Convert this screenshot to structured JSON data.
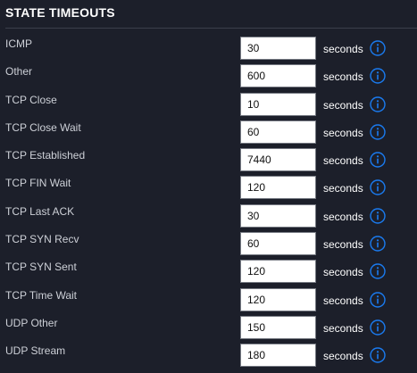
{
  "section": {
    "title": "STATE TIMEOUTS"
  },
  "colors": {
    "background": "#1c1f2a",
    "info_icon": "#1a7bf0",
    "input_border": "#767a83",
    "divider": "#3b3f4c"
  },
  "icons": {
    "info": "info-circle-icon"
  },
  "rows": [
    {
      "label": "ICMP",
      "value": "30",
      "unit": "seconds"
    },
    {
      "label": "Other",
      "value": "600",
      "unit": "seconds"
    },
    {
      "label": "TCP Close",
      "value": "10",
      "unit": "seconds"
    },
    {
      "label": "TCP Close Wait",
      "value": "60",
      "unit": "seconds"
    },
    {
      "label": "TCP Established",
      "value": "7440",
      "unit": "seconds"
    },
    {
      "label": "TCP FIN Wait",
      "value": "120",
      "unit": "seconds"
    },
    {
      "label": "TCP Last ACK",
      "value": "30",
      "unit": "seconds"
    },
    {
      "label": "TCP SYN Recv",
      "value": "60",
      "unit": "seconds"
    },
    {
      "label": "TCP SYN Sent",
      "value": "120",
      "unit": "seconds"
    },
    {
      "label": "TCP Time Wait",
      "value": "120",
      "unit": "seconds"
    },
    {
      "label": "UDP Other",
      "value": "150",
      "unit": "seconds"
    },
    {
      "label": "UDP Stream",
      "value": "180",
      "unit": "seconds"
    }
  ]
}
